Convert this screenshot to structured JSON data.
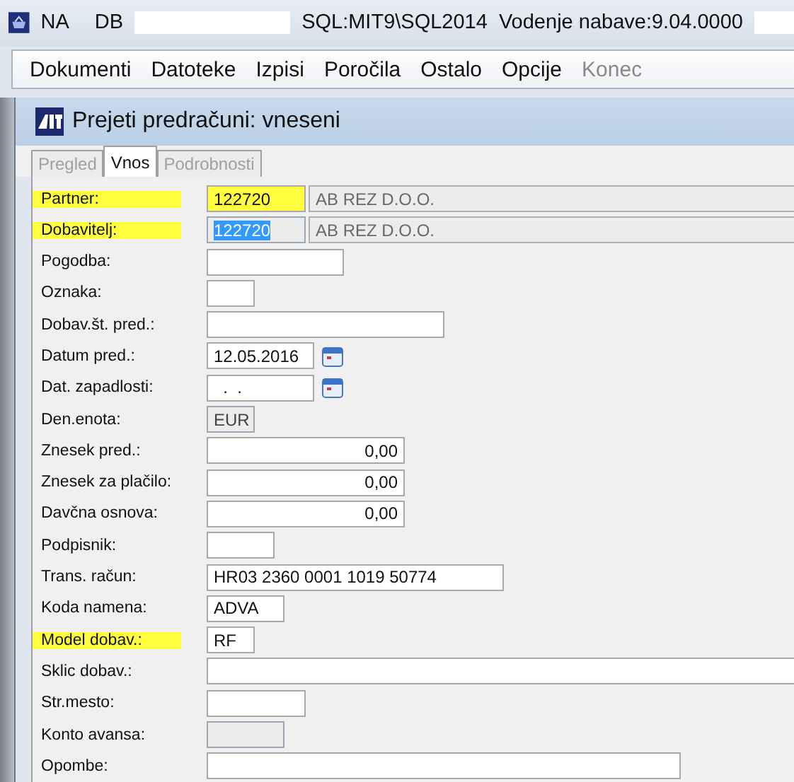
{
  "app_bar": {
    "app": "NA",
    "db_label": "DB",
    "server": "SQL:MIT9\\SQL2014",
    "version": "Vodenje nabave:9.04.0000"
  },
  "menu": [
    {
      "label": "Dokumenti",
      "disabled": false
    },
    {
      "label": "Datoteke",
      "disabled": false
    },
    {
      "label": "Izpisi",
      "disabled": false
    },
    {
      "label": "Poročila",
      "disabled": false
    },
    {
      "label": "Ostalo",
      "disabled": false
    },
    {
      "label": "Opcije",
      "disabled": false
    },
    {
      "label": "Konec",
      "disabled": true
    }
  ],
  "window": {
    "title": "Prejeti predračuni: vneseni"
  },
  "tabs": [
    {
      "label": "Pregled",
      "selected": false,
      "disabled": true
    },
    {
      "label": "Vnos",
      "selected": true,
      "disabled": false
    },
    {
      "label": "Podrobnosti",
      "selected": false,
      "disabled": true
    }
  ],
  "fields": [
    {
      "label": "Partner:",
      "kind": "code",
      "value": "122720",
      "highlighted": true,
      "value_highlighted": true,
      "selected": false,
      "disabled": false,
      "name": "AB REZ D.O.O."
    },
    {
      "label": "Dobavitelj:",
      "kind": "code",
      "value": "122720",
      "highlighted": true,
      "value_highlighted": false,
      "selected": true,
      "disabled": true,
      "name": "AB REZ D.O.O."
    },
    {
      "label": "Pogodba:",
      "kind": "medium",
      "highlighted": false,
      "disabled": false
    },
    {
      "label": "Oznaka:",
      "kind": "tiny",
      "highlighted": false,
      "disabled": false
    },
    {
      "label": "Dobav.št. pred.:",
      "kind": "wide",
      "highlighted": false,
      "disabled": false
    },
    {
      "label": "Datum pred.:",
      "kind": "date",
      "value": "12.05.2016",
      "highlighted": false,
      "disabled": false
    },
    {
      "label": "Dat. zapadlosti:",
      "kind": "date",
      "value": "  .  .",
      "highlighted": false,
      "disabled": false
    },
    {
      "label": "Den.enota:",
      "kind": "tiny",
      "value": "EUR",
      "highlighted": false,
      "disabled": true
    },
    {
      "label": "Znesek pred.:",
      "kind": "amount",
      "value": "0,00",
      "highlighted": false,
      "disabled": false
    },
    {
      "label": "Znesek za plačilo:",
      "kind": "amount",
      "value": "0,00",
      "highlighted": false,
      "disabled": false
    },
    {
      "label": "Davčna osnova:",
      "kind": "amount",
      "value": "0,00",
      "highlighted": false,
      "disabled": false
    },
    {
      "label": "Podpisnik:",
      "kind": "small",
      "highlighted": false,
      "disabled": false
    },
    {
      "label": "Trans. račun:",
      "kind": "account",
      "value": "HR03 2360 0001 1019 50774",
      "highlighted": false,
      "disabled": false
    },
    {
      "label": "Koda namena:",
      "kind": "short",
      "value": "ADVA",
      "highlighted": false,
      "disabled": false
    },
    {
      "label": "Model dobav.:",
      "kind": "tiny",
      "value": "RF",
      "highlighted": true,
      "disabled": false
    },
    {
      "label": "Sklic dobav.:",
      "kind": "full",
      "highlighted": false,
      "disabled": false
    },
    {
      "label": "Str.mesto:",
      "kind": "code",
      "highlighted": false,
      "disabled": false
    },
    {
      "label": "Konto avansa:",
      "kind": "short",
      "highlighted": false,
      "disabled": true
    },
    {
      "label": "Opombe:",
      "kind": "note",
      "highlighted": false,
      "disabled": false
    }
  ]
}
